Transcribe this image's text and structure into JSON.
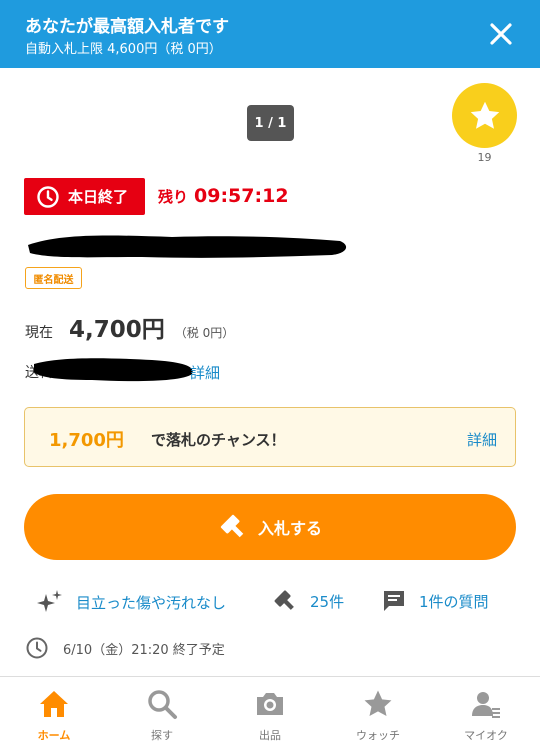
{
  "banner": {
    "title": "あなたが最高額入札者です",
    "subtitle": "自動入札上限 4,600円（税 0円）",
    "close_icon": "close-icon"
  },
  "image": {
    "counter": "1 / 1"
  },
  "favorite": {
    "count": "19",
    "icon": "star-icon"
  },
  "status": {
    "end_label": "本日終了",
    "remaining_label": "残り",
    "remaining_time": "09:57:12"
  },
  "tags": {
    "anonymous_shipping": "匿名配送"
  },
  "price": {
    "label": "現在",
    "value": "4,700円",
    "tax": "（税 0円）"
  },
  "shipping": {
    "label": "送料",
    "detail_link": "詳細"
  },
  "buy_now": {
    "amount": "1,700円",
    "text": "で落札のチャンス！",
    "detail_link": "詳細"
  },
  "bid_button": {
    "label": "入札する",
    "icon": "gavel-icon"
  },
  "info": {
    "condition": "目立った傷や汚れなし",
    "bids": "25件",
    "questions": "1件の質問"
  },
  "end_time": "6/10（金）21:20 終了予定",
  "nav": {
    "items": [
      {
        "label": "ホーム",
        "icon": "home-icon"
      },
      {
        "label": "探す",
        "icon": "search-icon"
      },
      {
        "label": "出品",
        "icon": "camera-icon"
      },
      {
        "label": "ウォッチ",
        "icon": "star-icon"
      },
      {
        "label": "マイオク",
        "icon": "account-icon"
      }
    ]
  },
  "colors": {
    "banner": "#1f9bde",
    "accent": "#ff8c00",
    "alert": "#e60012",
    "link": "#1a8bc9",
    "favorite": "#f9cf1c"
  }
}
